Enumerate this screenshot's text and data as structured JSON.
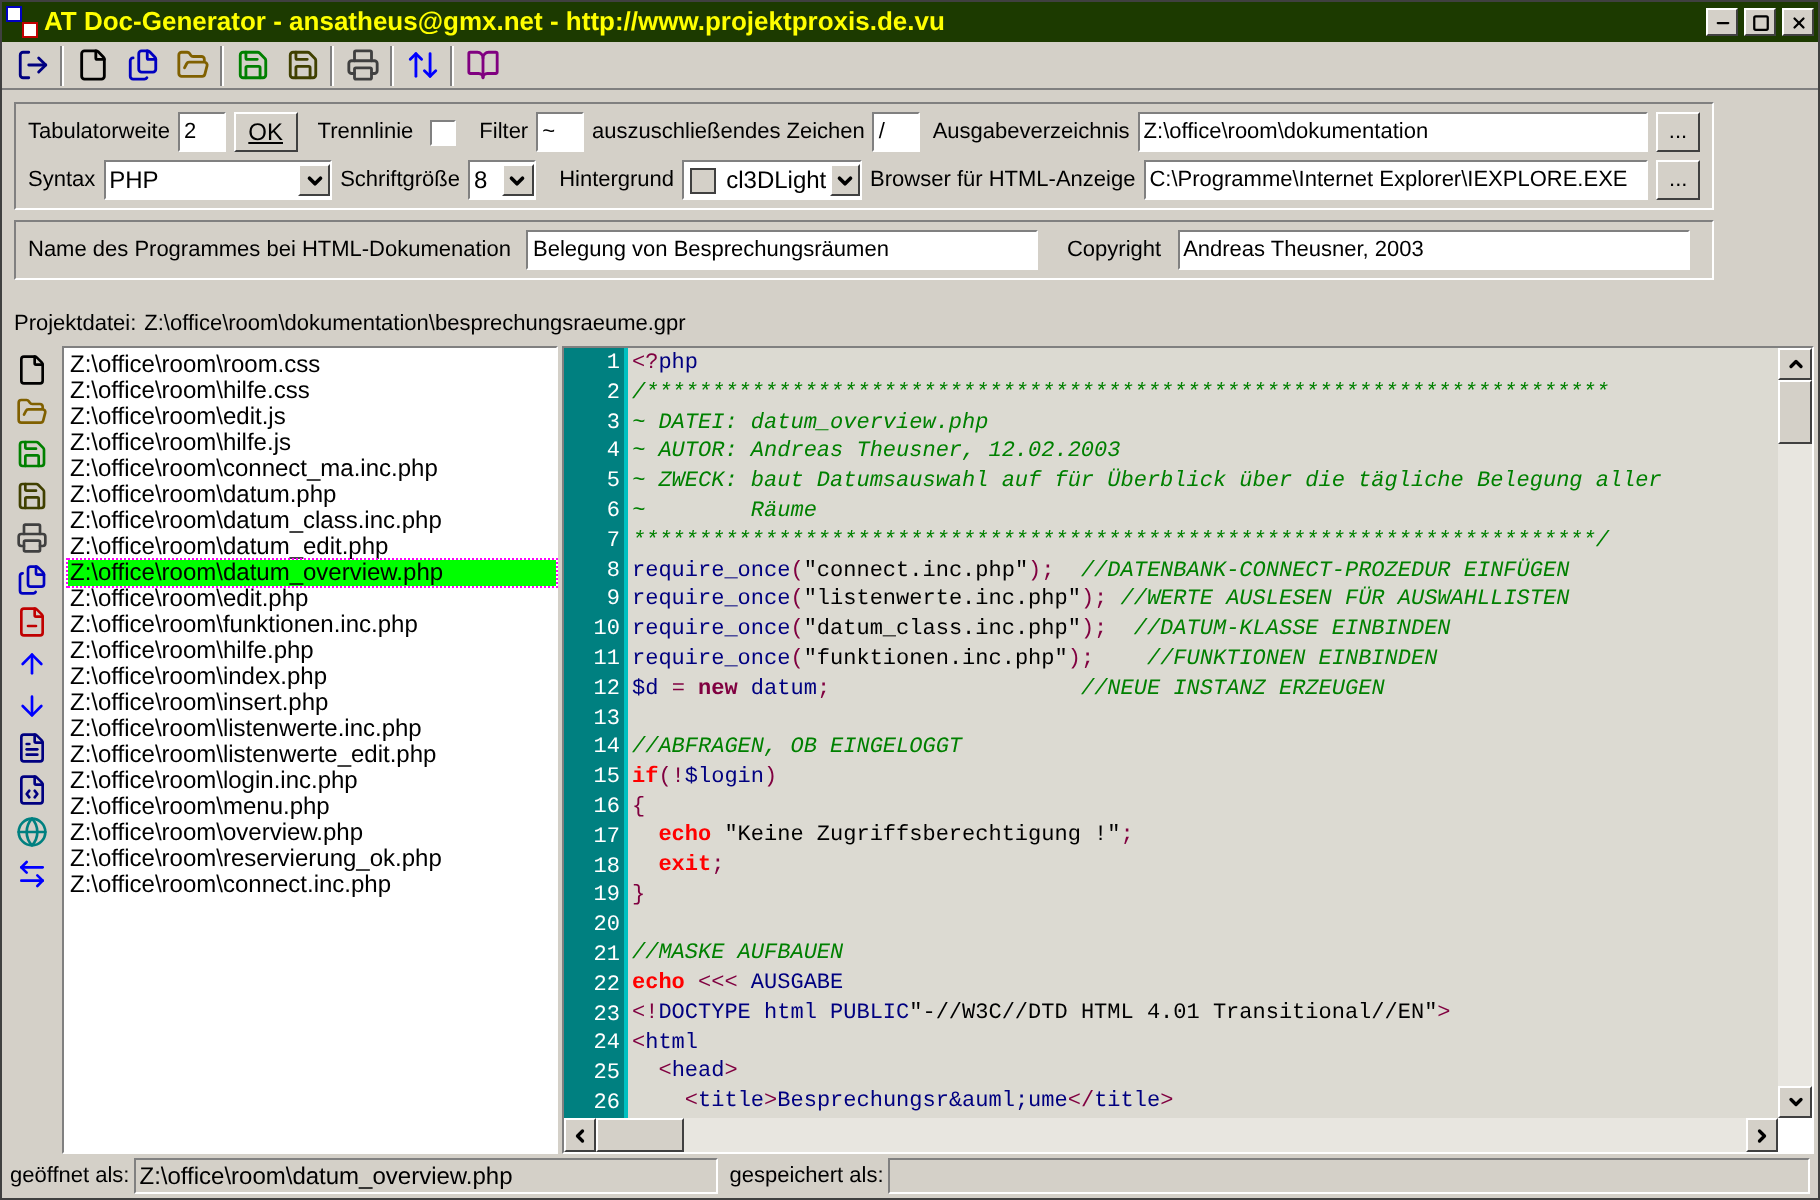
{
  "window": {
    "title": "AT Doc-Generator - ansatheus@gmx.net - http://www.projektproxis.de.vu"
  },
  "settings": {
    "tab_width": {
      "label": "Tabulatorweite",
      "value": "2"
    },
    "ok_button": "OK",
    "separator_line": {
      "label": "Trennlinie",
      "checked": false
    },
    "filter": {
      "label": "Filter",
      "value": "~"
    },
    "excluded_char": {
      "label": "auszuschließendes Zeichen",
      "value": "/"
    },
    "output_dir": {
      "label": "Ausgabeverzeichnis",
      "value": "Z:\\office\\room\\dokumentation",
      "browse": "..."
    },
    "syntax": {
      "label": "Syntax",
      "value": "PHP"
    },
    "font_size": {
      "label": "Schriftgröße",
      "value": "8"
    },
    "background": {
      "label": "Hintergrund",
      "value": "cl3DLight"
    },
    "browser": {
      "label": "Browser für HTML-Anzeige",
      "value": "C:\\Programme\\Internet Explorer\\IEXPLORE.EXE",
      "browse": "..."
    }
  },
  "doc": {
    "program_name": {
      "label": "Name des Programmes bei HTML-Dokumenation",
      "value": "Belegung von Besprechungsräumen"
    },
    "copyright": {
      "label": "Copyright",
      "value": "Andreas Theusner, 2003"
    }
  },
  "project_file": {
    "label": "Projektdatei:",
    "value": "Z:\\office\\room\\dokumentation\\besprechungsraeume.gpr"
  },
  "files": [
    {
      "path": "Z:\\office\\room\\room.css",
      "selected": false
    },
    {
      "path": "Z:\\office\\room\\hilfe.css",
      "selected": false
    },
    {
      "path": "Z:\\office\\room\\edit.js",
      "selected": false
    },
    {
      "path": "Z:\\office\\room\\hilfe.js",
      "selected": false
    },
    {
      "path": "Z:\\office\\room\\connect_ma.inc.php",
      "selected": false
    },
    {
      "path": "Z:\\office\\room\\datum.php",
      "selected": false
    },
    {
      "path": "Z:\\office\\room\\datum_class.inc.php",
      "selected": false
    },
    {
      "path": "Z:\\office\\room\\datum_edit.php",
      "selected": false
    },
    {
      "path": "Z:\\office\\room\\datum_overview.php",
      "selected": true
    },
    {
      "path": "Z:\\office\\room\\edit.php",
      "selected": false
    },
    {
      "path": "Z:\\office\\room\\funktionen.inc.php",
      "selected": false
    },
    {
      "path": "Z:\\office\\room\\hilfe.php",
      "selected": false
    },
    {
      "path": "Z:\\office\\room\\index.php",
      "selected": false
    },
    {
      "path": "Z:\\office\\room\\insert.php",
      "selected": false
    },
    {
      "path": "Z:\\office\\room\\listenwerte.inc.php",
      "selected": false
    },
    {
      "path": "Z:\\office\\room\\listenwerte_edit.php",
      "selected": false
    },
    {
      "path": "Z:\\office\\room\\login.inc.php",
      "selected": false
    },
    {
      "path": "Z:\\office\\room\\menu.php",
      "selected": false
    },
    {
      "path": "Z:\\office\\room\\overview.php",
      "selected": false
    },
    {
      "path": "Z:\\office\\room\\reservierung_ok.php",
      "selected": false
    },
    {
      "path": "Z:\\office\\room\\connect.inc.php",
      "selected": false
    }
  ],
  "code": [
    {
      "number": "1",
      "tokens": [
        {
          "kind": "sym",
          "text": "<?"
        },
        {
          "kind": "name",
          "text": "php"
        }
      ]
    },
    {
      "number": "2",
      "tokens": [
        {
          "kind": "comment",
          "text": "/*************************************************************************"
        }
      ]
    },
    {
      "number": "3",
      "tokens": [
        {
          "kind": "comment",
          "text": "~ DATEI: datum_overview.php"
        }
      ]
    },
    {
      "number": "4",
      "tokens": [
        {
          "kind": "comment",
          "text": "~ AUTOR: Andreas Theusner, 12.02.2003"
        }
      ]
    },
    {
      "number": "5",
      "tokens": [
        {
          "kind": "comment",
          "text": "~ ZWECK: baut Datumsauswahl auf für Überblick über die tägliche Belegung aller"
        }
      ]
    },
    {
      "number": "6",
      "tokens": [
        {
          "kind": "comment",
          "text": "~        Räume"
        }
      ]
    },
    {
      "number": "7",
      "tokens": [
        {
          "kind": "comment",
          "text": "*************************************************************************/"
        }
      ]
    },
    {
      "number": "8",
      "tokens": [
        {
          "kind": "name",
          "text": "require_once"
        },
        {
          "kind": "sym",
          "text": "("
        },
        {
          "kind": "string",
          "text": "\"connect.inc.php\""
        },
        {
          "kind": "sym",
          "text": ");"
        },
        {
          "kind": "comment",
          "text": "  //DATENBANK-CONNECT-PROZEDUR EINFÜGEN"
        }
      ]
    },
    {
      "number": "9",
      "tokens": [
        {
          "kind": "name",
          "text": "require_once"
        },
        {
          "kind": "sym",
          "text": "("
        },
        {
          "kind": "string",
          "text": "\"listenwerte.inc.php\""
        },
        {
          "kind": "sym",
          "text": ");"
        },
        {
          "kind": "comment",
          "text": " //WERTE AUSLESEN FÜR AUSWAHLLISTEN"
        }
      ]
    },
    {
      "number": "10",
      "tokens": [
        {
          "kind": "name",
          "text": "require_once"
        },
        {
          "kind": "sym",
          "text": "("
        },
        {
          "kind": "string",
          "text": "\"datum_class.inc.php\""
        },
        {
          "kind": "sym",
          "text": ");"
        },
        {
          "kind": "comment",
          "text": "  //DATUM-KLASSE EINBINDEN"
        }
      ]
    },
    {
      "number": "11",
      "tokens": [
        {
          "kind": "name",
          "text": "require_once"
        },
        {
          "kind": "sym",
          "text": "("
        },
        {
          "kind": "string",
          "text": "\"funktionen.inc.php\""
        },
        {
          "kind": "sym",
          "text": ");"
        },
        {
          "kind": "comment",
          "text": "    //FUNKTIONEN EINBINDEN"
        }
      ]
    },
    {
      "number": "12",
      "tokens": [
        {
          "kind": "name",
          "text": "$d "
        },
        {
          "kind": "sym",
          "text": "="
        },
        {
          "kind": "operator",
          "text": " new"
        },
        {
          "kind": "name",
          "text": " datum"
        },
        {
          "kind": "sym",
          "text": ";"
        },
        {
          "kind": "comment",
          "text": "                   //NEUE INSTANZ ERZEUGEN"
        }
      ]
    },
    {
      "number": "13"
    },
    {
      "number": "14",
      "tokens": [
        {
          "kind": "comment",
          "text": "//ABFRAGEN, OB EINGELOGGT"
        }
      ]
    },
    {
      "number": "15",
      "tokens": [
        {
          "kind": "keyword",
          "text": "if"
        },
        {
          "kind": "sym",
          "text": "(!"
        },
        {
          "kind": "name",
          "text": "$login"
        },
        {
          "kind": "sym",
          "text": ")"
        }
      ]
    },
    {
      "number": "16",
      "tokens": [
        {
          "kind": "sym",
          "text": "{"
        }
      ]
    },
    {
      "number": "17",
      "tokens": [
        {
          "kind": "keyword",
          "text": "  echo"
        },
        {
          "kind": "string",
          "text": " \"Keine Zugriffsberechtigung !\""
        },
        {
          "kind": "sym",
          "text": ";"
        }
      ]
    },
    {
      "number": "18",
      "tokens": [
        {
          "kind": "keyword",
          "text": "  exit"
        },
        {
          "kind": "sym",
          "text": ";"
        }
      ]
    },
    {
      "number": "19",
      "tokens": [
        {
          "kind": "sym",
          "text": "}"
        }
      ]
    },
    {
      "number": "20"
    },
    {
      "number": "21",
      "tokens": [
        {
          "kind": "comment",
          "text": "//MASKE AUFBAUEN"
        }
      ]
    },
    {
      "number": "22",
      "tokens": [
        {
          "kind": "keyword",
          "text": "echo"
        },
        {
          "kind": "sym",
          "text": " <<<"
        },
        {
          "kind": "name",
          "text": " AUSGABE"
        }
      ]
    },
    {
      "number": "23",
      "tokens": [
        {
          "kind": "sym",
          "text": "<!"
        },
        {
          "kind": "name",
          "text": "DOCTYPE html PUBLIC"
        },
        {
          "kind": "string",
          "text": "\"-//W3C//DTD HTML 4.01 Transitional//EN\""
        },
        {
          "kind": "sym",
          "text": ">"
        }
      ]
    },
    {
      "number": "24",
      "tokens": [
        {
          "kind": "sym",
          "text": "<"
        },
        {
          "kind": "name",
          "text": "html"
        }
      ]
    },
    {
      "number": "25",
      "tokens": [
        {
          "kind": "sym",
          "text": "  <"
        },
        {
          "kind": "name",
          "text": "head"
        },
        {
          "kind": "sym",
          "text": ">"
        }
      ]
    },
    {
      "number": "26",
      "tokens": [
        {
          "kind": "sym",
          "text": "    <"
        },
        {
          "kind": "name",
          "text": "title"
        },
        {
          "kind": "sym",
          "text": ">"
        },
        {
          "kind": "name",
          "text": "Besprechungsr&auml;ume"
        },
        {
          "kind": "sym",
          "text": "</"
        },
        {
          "kind": "name",
          "text": "title"
        },
        {
          "kind": "sym",
          "text": ">"
        }
      ]
    }
  ],
  "status_bar": {
    "opened_label": "geöffnet als:",
    "opened_value": "Z:\\office\\room\\datum_overview.php",
    "saved_label": "gespeichert als:"
  }
}
